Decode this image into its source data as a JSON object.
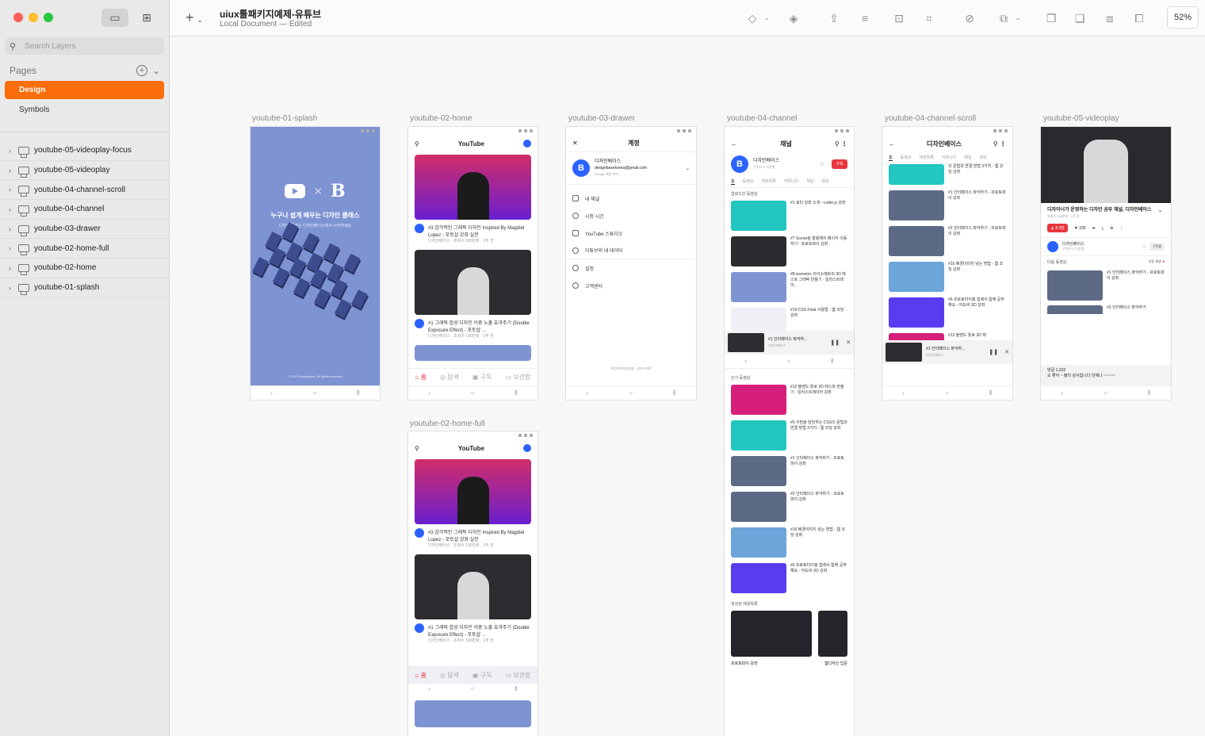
{
  "sidebar": {
    "search_placeholder": "Search Layers",
    "pages_label": "Pages",
    "pages": [
      "Design",
      "Symbols"
    ],
    "layers": [
      "youtube-05-videoplay-focus",
      "youtube-05-videoplay",
      "youtube-04-channel-scroll",
      "youtube-04-channel",
      "youtube-03-drawer",
      "youtube-02-home-full",
      "youtube-02-home",
      "youtube-01-splash"
    ]
  },
  "toolbar": {
    "doc_title": "uiux툴패키지예제-유튜브",
    "doc_subtitle": "Local Document — Edited",
    "zoom": "52%",
    "icons": [
      "plus-icon",
      "diamond-icon",
      "symbol-icon",
      "upload-icon",
      "align-icon",
      "frame-icon",
      "crop-icon",
      "edit-icon",
      "mask-icon",
      "union-icon",
      "subtract-icon",
      "intersect-icon",
      "difference-icon"
    ]
  },
  "artboards": {
    "splash": {
      "label": "youtube-01-splash",
      "logo_b": "B",
      "title": "누구나 쉽게 배우는 디자인 클래스",
      "subtitle": "디자인 공부는 디자인베이스에서 시작하세요",
      "copyright": "© 2022 Designbase. All rights reserved."
    },
    "home": {
      "label": "youtube-02-home",
      "app_title": "YouTube",
      "videos": [
        {
          "title": "#3 감각적인 그래픽 디자인 Inspired By Magdiel Lopez - 포토샵 강좌 실전",
          "meta": "디자인베이스 · 조회수 100만회 · 1주 전"
        },
        {
          "title": "#1 그래픽 합성 디자인 이중 노출 효과주기 (Double Exposure Effect) - 포토샵 ...",
          "meta": "디자인베이스 · 조회수 100만회 · 1주 전"
        }
      ],
      "tabs": [
        "홈",
        "탐색",
        "구독",
        "보관함"
      ]
    },
    "home_full": {
      "label": "youtube-02-home-full"
    },
    "drawer": {
      "label": "youtube-03-drawer",
      "header": "계정",
      "account_name": "디자인베이스",
      "account_email": "designbasekorea@gmail.com",
      "account_manage": "Google 계정 관리",
      "menu": [
        "내 채널",
        "시청 시간",
        "YouTube 스튜디오",
        "디튜브의 내 데이터",
        "설정",
        "고객센터"
      ],
      "footer": "개인정보처리방침 · 서비스약관"
    },
    "channel": {
      "label": "youtube-04-channel",
      "header": "채널",
      "name": "디자인베이스",
      "subs": "구독자 3.71만명",
      "subscribe": "구독",
      "tabs": [
        "홈",
        "동영상",
        "재생목록",
        "커뮤니티",
        "채널",
        "정보"
      ],
      "section_uploads": "업로드한 동영상",
      "uploads": [
        "#1 로티 강좌 소개 - Lottie.js 강좌",
        "#7 Scene을 활용해서 페이지 이동하기 - 프로토파이 강좌",
        "#8 isometric 아이소메트릭 3D 텍스트 그래픽 만들기 - 일러스트레이...",
        "#14 CSS Float 사용법 - 웹 코딩 강좌"
      ],
      "mini_title": "#1 인터페이스 파악하...",
      "mini_sub": "디자인베이스",
      "section_popular": "인기 동영상",
      "popular": [
        "#12 블렌드 툴로 3D 텍스트 만들기 - 일러스트레이터 강좌",
        "#5 꾸밈을 담당하는 CSS의 문법과 연결 방법 3가지 - 웹 코딩 강좌",
        "#1 인터페이스 파악하기 - 프로토파이 강좌",
        "#2 인터페이스 파악하기 - 프로토파이 강좌",
        "#16 배경이미지 넣는 방법 - 웹 코딩 강좌",
        "#6 프로토타이핑 집에서 함께 공부해요 - 어도비 XD 강좌"
      ],
      "section_playlists": "생성된 재생목록",
      "playlist": "프로토파이 강좌",
      "playlist2": "웹디자인 입문"
    },
    "channel_scroll": {
      "label": "youtube-04-channel-scroll",
      "header": "디자인베이스",
      "videos": [
        "의 문법과 연결 방법 3가지 - 웹 코딩 강좌",
        "#1 인터페이스 파악하기 - 프로토파이 강좌",
        "#2 인터페이스 파악하기 - 프로토파이 강좌",
        "#16 배경이미지 넣는 방법 - 웹 코딩 강좌",
        "#6 프로토타이핑 집에서 함께 공부해요 - 어도비 XD 강좌",
        "#12 블렌드 툴로 3D 텍"
      ]
    },
    "videoplay": {
      "label": "youtube-05-videoplay",
      "title": "디자이너가 운영하는 디자인 공부 채널, 디자인베이스",
      "meta": "조회수 100만회 · 1주 전",
      "likes": "8.3만",
      "dislikes": "235",
      "channel": "디자인베이스",
      "channel_subs": "구독자 3.71만명",
      "subscribe": "구독중",
      "next_label": "다음 동영상",
      "autoplay": "자동 재생",
      "next_video": "#1 인터페이스 파악하기 - 프로토파이 강좌",
      "next_video2": "#2 인터페이스 파악하기",
      "comments": "댓글 1,332",
      "comment": "오 좋아 ~ 블리 감사합니다 언제나 ~~~~~"
    }
  }
}
